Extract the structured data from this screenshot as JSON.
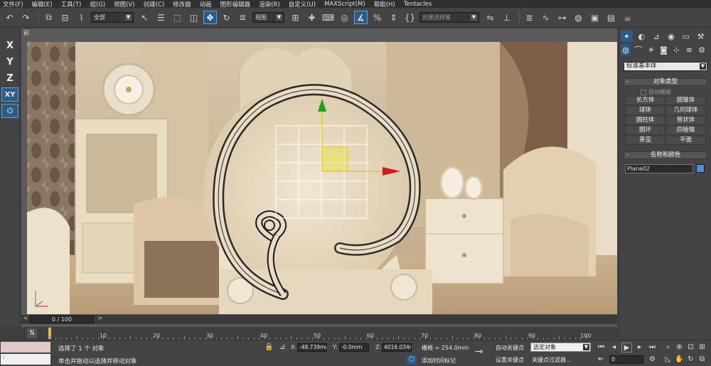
{
  "menu": [
    "文件(F)",
    "编辑(E)",
    "工具(T)",
    "组(G)",
    "视图(V)",
    "创建(C)",
    "修改器",
    "动画",
    "图形编辑器",
    "渲染(R)",
    "自定义(U)",
    "MAXScript(M)",
    "帮助(H)",
    "Tentacles"
  ],
  "toolbar": {
    "filter_dropdown": "全部",
    "coord_dropdown": "视图",
    "selection_set_dropdown": "创建选择集"
  },
  "left_axes": [
    "X",
    "Y",
    "Z",
    "XY"
  ],
  "viewport": {
    "label": "前"
  },
  "timeline": {
    "frame_box": "0 / 100",
    "ruler_labels": [
      "10",
      "20",
      "30",
      "40",
      "50",
      "60",
      "70",
      "80",
      "90",
      "100"
    ]
  },
  "status": {
    "selection_text": "选择了 1 个 对象",
    "prompt_text": "单击并拖动以选择并移动对象",
    "x_value": "-48.739mm",
    "y_value": "-0.0mm",
    "z_value": "4016.034mm",
    "grid_text": "栅格 = 254.0mm",
    "add_time_tag": "添加时间标记",
    "auto_key": "自动关键点",
    "set_key": "设置关键点",
    "selected_object": "选定对象",
    "key_filters": "关键点过滤器...",
    "frame_value": "0",
    "white_box": ":"
  },
  "cmdpanel": {
    "category": "标准基本体",
    "object_type_title": "对象类型",
    "auto_grid": "自动栅格",
    "objects": [
      "长方体",
      "圆锥体",
      "球体",
      "几何球体",
      "圆柱体",
      "管状体",
      "圆环",
      "四棱锥",
      "茶壶",
      "平面"
    ],
    "name_color_title": "名称和颜色",
    "object_name": "Plane02",
    "object_color": "#4a90d9"
  }
}
